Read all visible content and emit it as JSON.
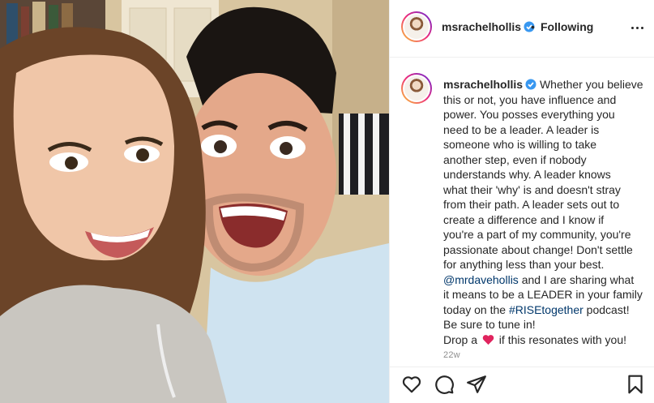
{
  "post": {
    "username": "msrachelhollis",
    "follow_separator": "•",
    "follow_status": "Following",
    "caption_lines": [
      "Whether you believe",
      "this or not, you have influence and",
      "power. You posses everything you",
      "need to be a leader. A leader is",
      "someone who is willing to take",
      "another step, even if nobody",
      "understands why. A leader knows",
      "what their 'why' is and doesn't stray",
      "from their path. A leader sets out to",
      "create a difference and I know if",
      "you're a part of my community, you're",
      "passionate about change! Don't settle",
      "for anything less than your best."
    ],
    "mention": "@mrdavehollis",
    "caption_after_mention": " and I are sharing what",
    "caption_line_15": "it means to be a LEADER in your family",
    "caption_line_16_before": "today on the ",
    "hashtag": "#RISEtogether",
    "caption_line_16_after": " podcast!",
    "caption_line_17": "Be sure to tune in!",
    "drop_before": "Drop a ",
    "drop_after": " if this resonates with you!",
    "timestamp": "22w"
  },
  "icons": {
    "verified": "verified-badge-icon",
    "more": "more-options-icon",
    "like": "heart-outline-icon",
    "comment": "comment-bubble-icon",
    "share": "paper-plane-icon",
    "save": "bookmark-icon",
    "emoji": "red-heart-emoji"
  },
  "colors": {
    "verified": "#3897f0",
    "link": "#00376b",
    "heart_emoji": "#e0245e",
    "muted": "#8e8e8e"
  }
}
